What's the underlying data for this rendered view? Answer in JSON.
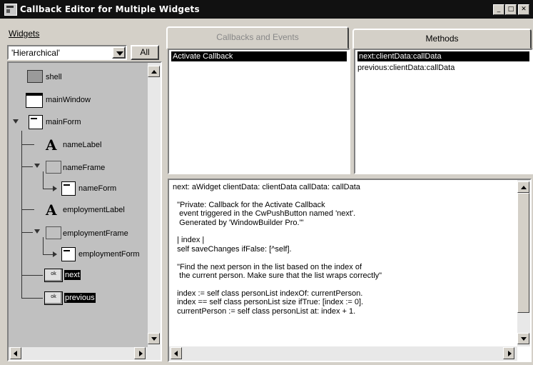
{
  "window": {
    "title": "Callback Editor for Multiple Widgets",
    "controls": {
      "minimize": "_",
      "maximize": "□",
      "close": "✕"
    }
  },
  "widgets": {
    "label": "Widgets",
    "view_select": "'Hierarchical'",
    "all_button": "All",
    "tree": [
      {
        "label": "shell",
        "icon": "shell-icon"
      },
      {
        "label": "mainWindow",
        "icon": "window-icon"
      },
      {
        "label": "mainForm",
        "icon": "form-icon"
      },
      {
        "label": "nameLabel",
        "icon": "label-a-icon"
      },
      {
        "label": "nameFrame",
        "icon": "frame-icon"
      },
      {
        "label": "nameForm",
        "icon": "form-icon"
      },
      {
        "label": "employmentLabel",
        "icon": "label-a-icon"
      },
      {
        "label": "employmentFrame",
        "icon": "frame-icon"
      },
      {
        "label": "employmentForm",
        "icon": "form-icon"
      },
      {
        "label": "next",
        "icon": "push-button-icon",
        "selected": true
      },
      {
        "label": "previous",
        "icon": "push-button-icon",
        "selected": true
      }
    ],
    "button_icon_text": "ok"
  },
  "tabs": {
    "callbacks": "Callbacks and Events",
    "methods": "Methods"
  },
  "callbacks_list": [
    "Activate Callback"
  ],
  "methods_list": [
    "next:clientData:callData",
    "previous:clientData:callData"
  ],
  "code_text": "next: aWidget clientData: clientData callData: callData\n\n  \"Private: Callback for the Activate Callback\n   event triggered in the CwPushButton named 'next'.\n   Generated by 'WindowBuilder Pro.'\"\n\n  | index |\n  self saveChanges ifFalse: [^self].\n\n  \"Find the next person in the list based on the index of\n   the current person. Make sure that the list wraps correctly\"\n\n  index := self class personList indexOf: currentPerson.\n  index == self class personList size ifTrue: [index := 0].\n  currentPerson := self class personList at: index + 1."
}
